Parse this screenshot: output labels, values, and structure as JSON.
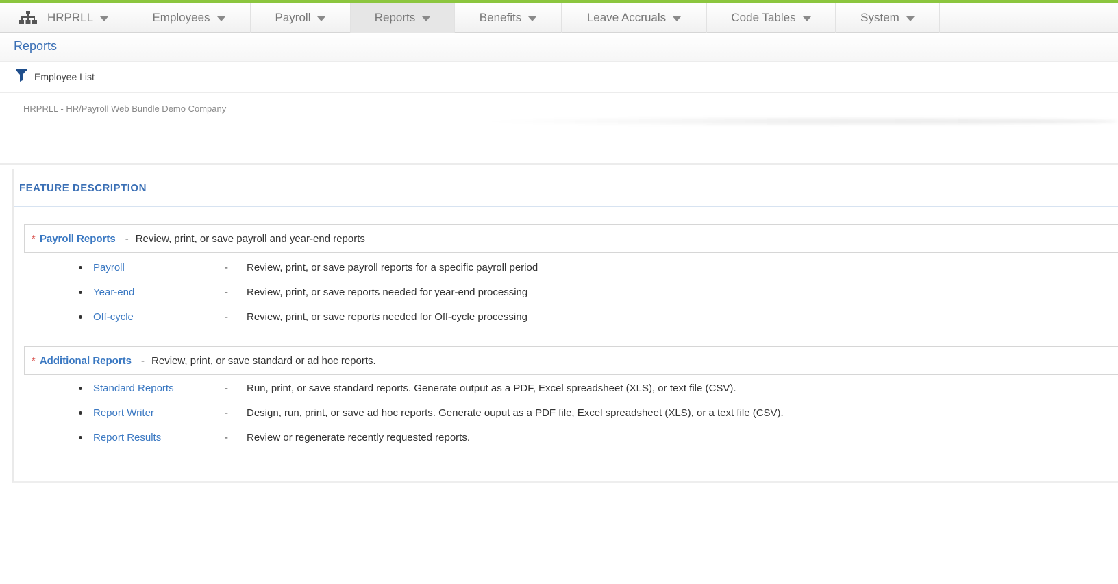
{
  "nav": {
    "items": [
      {
        "label": "HRPRLL",
        "icon": "org-chart-icon"
      },
      {
        "label": "Employees"
      },
      {
        "label": "Payroll"
      },
      {
        "label": "Reports",
        "active": true
      },
      {
        "label": "Benefits"
      },
      {
        "label": "Leave Accruals"
      },
      {
        "label": "Code Tables"
      },
      {
        "label": "System"
      }
    ]
  },
  "breadcrumb": "Reports",
  "toolbar": {
    "employee_list_label": "Employee List",
    "icon": "filter-icon"
  },
  "company": "HRPRLL - HR/Payroll Web Bundle Demo Company",
  "panel": {
    "title": "FEATURE DESCRIPTION",
    "sections": [
      {
        "title": "Payroll Reports",
        "description": "Review, print, or save payroll and year-end reports",
        "items": [
          {
            "label": "Payroll",
            "description": "Review, print, or save payroll reports for a specific payroll period"
          },
          {
            "label": "Year-end",
            "description": "Review, print, or save reports needed for year-end processing"
          },
          {
            "label": "Off-cycle",
            "description": "Review, print, or save reports needed for Off-cycle processing"
          }
        ]
      },
      {
        "title": "Additional Reports",
        "description": "Review, print, or save standard or ad hoc reports.",
        "items": [
          {
            "label": "Standard Reports",
            "description": "Run, print, or save standard reports. Generate output as a PDF, Excel spreadsheet (XLS), or text file (CSV)."
          },
          {
            "label": "Report Writer",
            "description": "Design, run, print, or save ad hoc reports. Generate ouput as a PDF file, Excel spreadsheet (XLS), or a text file (CSV)."
          },
          {
            "label": "Report Results",
            "description": "Review or regenerate recently requested reports."
          }
        ]
      }
    ]
  },
  "colors": {
    "accent": "#8cc63f",
    "link": "#3a78c2",
    "asterisk": "#d9534f"
  }
}
